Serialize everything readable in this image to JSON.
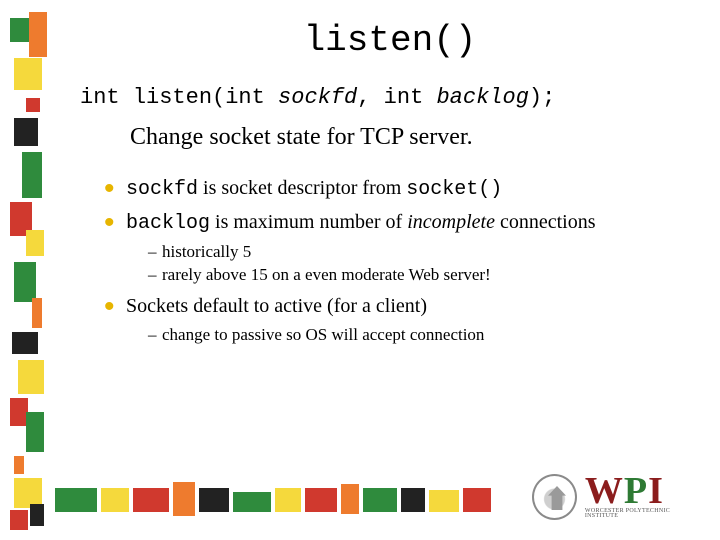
{
  "title": "listen()",
  "signature": {
    "ret": "int ",
    "name": "listen",
    "open": "(int ",
    "p1": "sockfd",
    "mid": ", int ",
    "p2": "backlog",
    "close": ");"
  },
  "subtitle": "Change socket state for TCP server.",
  "bullets": [
    {
      "pre": "",
      "code1": "sockfd",
      "mid": " is socket descriptor from ",
      "code2": "socket()",
      "post": ""
    },
    {
      "pre": "",
      "code1": "backlog",
      "mid": " is maximum number of ",
      "ital": "incomplete",
      "post": " connections",
      "sub": [
        "historically 5",
        "rarely above 15 on a even moderate Web server!"
      ]
    },
    {
      "pre": "Sockets default to active (for a client)",
      "sub": [
        "change to passive so OS will accept connection"
      ]
    }
  ],
  "logo": {
    "letters": [
      "W",
      "P",
      "I"
    ],
    "subtitle": "WORCESTER POLYTECHNIC INSTITUTE"
  }
}
